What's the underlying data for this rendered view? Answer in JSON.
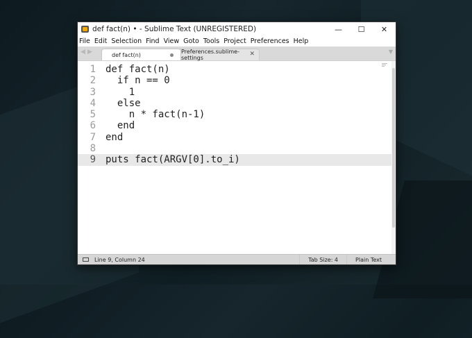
{
  "window": {
    "title": "def fact(n) • - Sublime Text (UNREGISTERED)",
    "controls": {
      "minimize": "—",
      "maximize": "☐",
      "close": "✕"
    }
  },
  "menu": [
    "File",
    "Edit",
    "Selection",
    "Find",
    "View",
    "Goto",
    "Tools",
    "Project",
    "Preferences",
    "Help"
  ],
  "tabs": [
    {
      "label": "def fact(n)",
      "active": true,
      "dirty": true
    },
    {
      "label": "Preferences.sublime-settings",
      "active": false
    }
  ],
  "tab_nav": {
    "prev": "◀",
    "next": "▶",
    "dropdown": "▼"
  },
  "editor": {
    "lines": [
      {
        "num": "1",
        "text": "def fact(n)"
      },
      {
        "num": "2",
        "text": "  if n == 0"
      },
      {
        "num": "3",
        "text": "    1"
      },
      {
        "num": "4",
        "text": "  else"
      },
      {
        "num": "5",
        "text": "    n * fact(n-1)"
      },
      {
        "num": "6",
        "text": "  end"
      },
      {
        "num": "7",
        "text": "end"
      },
      {
        "num": "8",
        "text": ""
      },
      {
        "num": "9",
        "text": "puts fact(ARGV[0].to_i)"
      }
    ],
    "current_line": "9"
  },
  "status": {
    "position": "Line 9, Column 24",
    "tab_size": "Tab Size: 4",
    "syntax": "Plain Text"
  }
}
